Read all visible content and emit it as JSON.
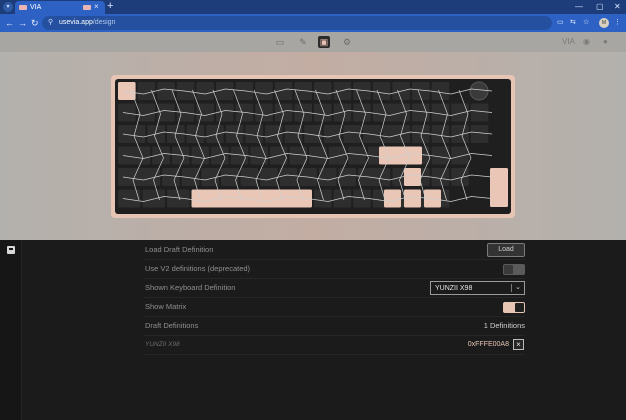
{
  "browser": {
    "tab_title": "VIA",
    "url_host": "usevia.app",
    "url_path": "/design",
    "profile_initials": "M",
    "new_tab_label": "+",
    "tab_close_label": "×"
  },
  "via_nav": {
    "items": [
      "keyboard-nav-icon",
      "paint-icon",
      "design-icon",
      "settings-icon"
    ],
    "active": "design-icon",
    "right_logo": "VIA"
  },
  "keyboard_preview": {
    "case_color": "#e6c5b5",
    "plate_color": "#1f1f1f",
    "key_color": "#2e2e2e",
    "highlight_key_color": "#e9c6b6",
    "matrix_line_color": "#d0d0d0",
    "has_knob": true
  },
  "panel": {
    "rows": [
      {
        "label": "Load Draft Definition",
        "button_label": "Load"
      },
      {
        "label": "Use V2 definitions (deprecated)",
        "toggle_on": false
      },
      {
        "label": "Shown Keyboard Definition",
        "selected": "YUNZII X98"
      },
      {
        "label": "Show Matrix",
        "toggle_on": true
      },
      {
        "label": "Draft Definitions",
        "value": "1 Definitions"
      },
      {
        "label": "YUNZII X98",
        "vendor_product_id": "0xFFFE00A8",
        "remove_label": "×"
      }
    ]
  },
  "colors": {
    "accent": "#e6c5b5",
    "panel_bg": "#1b1b1b",
    "browser_blue": "#2d62c4"
  }
}
